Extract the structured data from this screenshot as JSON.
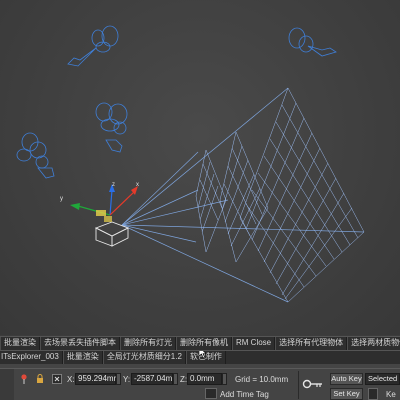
{
  "viewport": {
    "label": "3D perspective viewport",
    "wire_color": "#3f7fd8",
    "grid_color": "#8fb0e8",
    "camera_color": "#e8e8e8"
  },
  "script_toolbar": {
    "row1": [
      "批量渲染",
      "去场景丢失插件脚本",
      "删除所有灯光",
      "删除所有像机",
      "RM Close",
      "选择所有代理物体",
      "选择两材质物体"
    ],
    "row2": [
      "ITsExplorer_003",
      "批量渲染",
      "全局灯光材质细分1.2",
      "软包制作"
    ]
  },
  "status_bar": {
    "x_label": "X:",
    "x_value": "959.294mr",
    "y_label": "Y:",
    "y_value": "-2587.04m",
    "z_label": "Z:",
    "z_value": "0.0mm",
    "grid_label": "Grid = 10.0mm",
    "add_time_tag": "Add Time Tag",
    "auto_key": "Auto Key",
    "selected": "Selected",
    "set_key": "Set Key",
    "key_label": "Ke"
  },
  "icons": [
    "pin-icon",
    "lock-icon",
    "absolute-mode-icon",
    "key-icon",
    "add-time-tag-icon",
    "key-filter-icon"
  ]
}
